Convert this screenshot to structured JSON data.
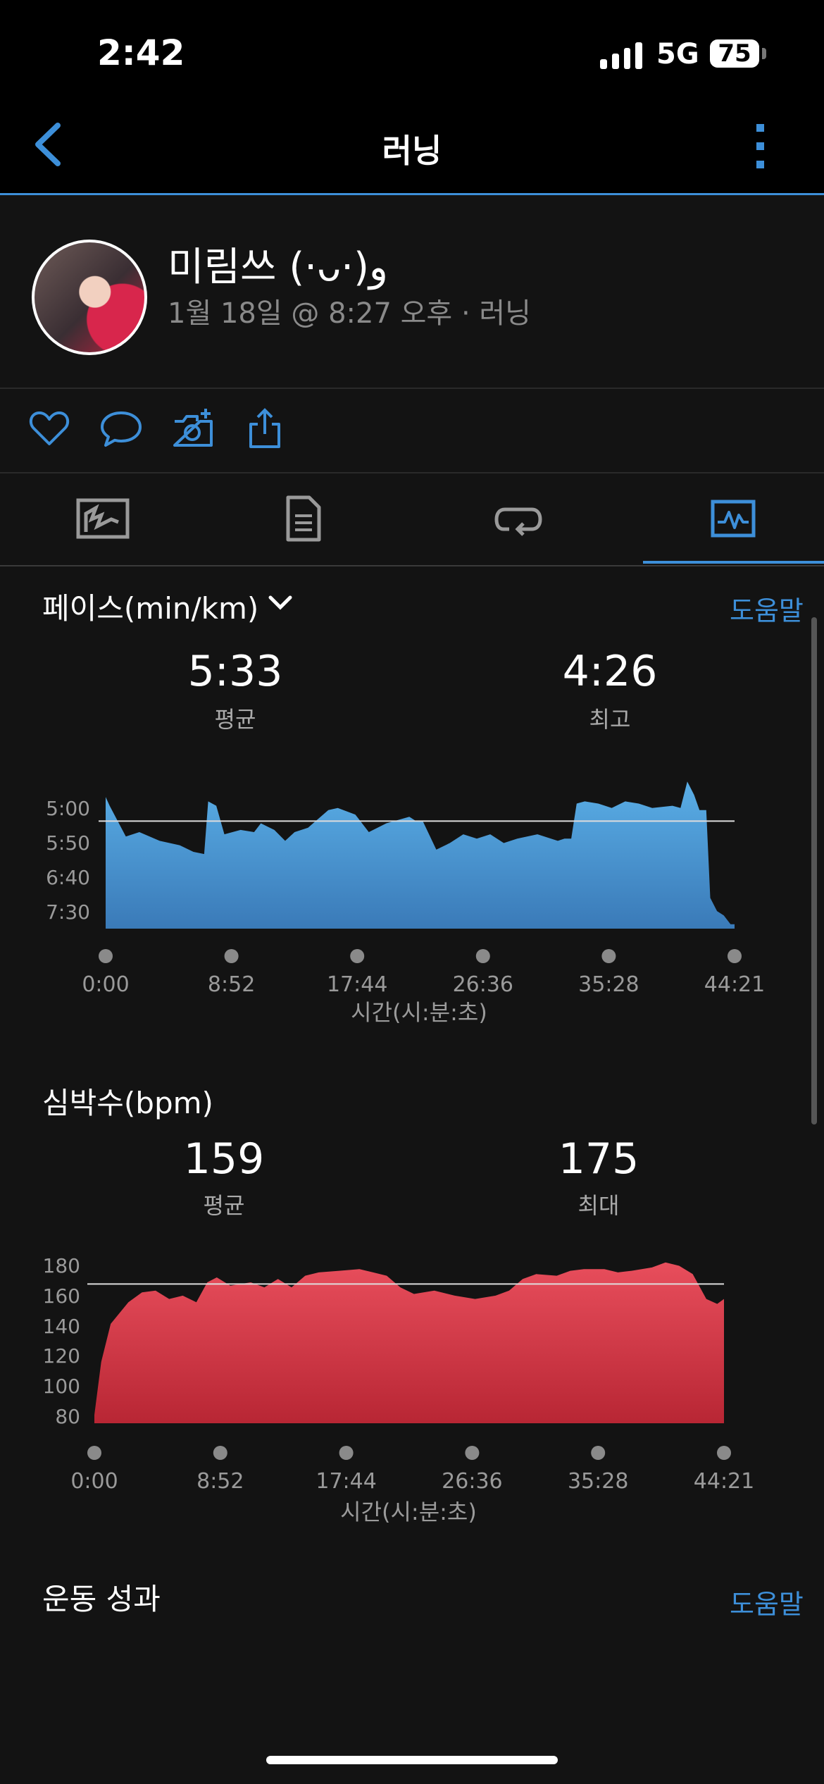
{
  "status_bar": {
    "time": "2:42",
    "network": "5G",
    "battery": "75"
  },
  "nav": {
    "title": "러닝"
  },
  "activity": {
    "user_name": "미림쓰 (·ᴗ·)و",
    "meta": "1월 18일 @ 8:27 오후 · 러닝"
  },
  "pace": {
    "title": "페이스(min/km)",
    "help": "도움말",
    "avg_value": "5:33",
    "avg_label": "평균",
    "best_value": "4:26",
    "best_label": "최고",
    "y_ticks": [
      "5:00",
      "5:50",
      "6:40",
      "7:30"
    ],
    "x_ticks": [
      "0:00",
      "8:52",
      "17:44",
      "26:36",
      "35:28",
      "44:21"
    ],
    "x_label": "시간(시:분:초)"
  },
  "heart": {
    "title": "심박수(bpm)",
    "avg_value": "159",
    "avg_label": "평균",
    "max_value": "175",
    "max_label": "최대",
    "y_ticks": [
      "180",
      "160",
      "140",
      "120",
      "100",
      "80"
    ],
    "x_ticks": [
      "0:00",
      "8:52",
      "17:44",
      "26:36",
      "35:28",
      "44:21"
    ],
    "x_label": "시간(시:분:초)"
  },
  "performance": {
    "title": "운동 성과",
    "help": "도움말"
  },
  "colors": {
    "accent": "#3d8fd9",
    "pace_fill": "#4a9ed8",
    "hr_fill": "#d63848"
  },
  "chart_data": [
    {
      "type": "area",
      "title": "페이스(min/km)",
      "xlabel": "시간(시:분:초)",
      "x_unit": "minutes",
      "y_unit": "min/km (inverted axis)",
      "ylim": [
        4.5,
        8.0
      ],
      "average": 5.55,
      "points": [
        [
          0,
          5.0
        ],
        [
          0.3,
          5.2
        ],
        [
          1.5,
          5.9
        ],
        [
          2.5,
          5.8
        ],
        [
          4,
          6.0
        ],
        [
          5.5,
          6.1
        ],
        [
          6.5,
          6.25
        ],
        [
          7.3,
          6.3
        ],
        [
          7.6,
          5.1
        ],
        [
          8.2,
          5.2
        ],
        [
          8.8,
          5.85
        ],
        [
          10,
          5.75
        ],
        [
          11,
          5.8
        ],
        [
          11.5,
          5.6
        ],
        [
          12.5,
          5.75
        ],
        [
          13.3,
          6.0
        ],
        [
          14,
          5.8
        ],
        [
          15,
          5.7
        ],
        [
          16.5,
          5.3
        ],
        [
          17.2,
          5.25
        ],
        [
          18.5,
          5.4
        ],
        [
          19.5,
          5.8
        ],
        [
          20.8,
          5.6
        ],
        [
          22.5,
          5.45
        ],
        [
          23,
          5.55
        ],
        [
          23.5,
          5.55
        ],
        [
          24.5,
          6.2
        ],
        [
          25.5,
          6.05
        ],
        [
          26.5,
          5.85
        ],
        [
          27.5,
          5.95
        ],
        [
          28.5,
          5.85
        ],
        [
          29.5,
          6.05
        ],
        [
          30.5,
          5.95
        ],
        [
          32,
          5.85
        ],
        [
          33.5,
          6.0
        ],
        [
          34,
          5.95
        ],
        [
          34.5,
          5.95
        ],
        [
          34.9,
          5.15
        ],
        [
          35.5,
          5.1
        ],
        [
          36.5,
          5.15
        ],
        [
          37.5,
          5.25
        ],
        [
          38.5,
          5.1
        ],
        [
          39.5,
          5.15
        ],
        [
          40.5,
          5.25
        ],
        [
          42,
          5.2
        ],
        [
          42.6,
          5.25
        ],
        [
          43.1,
          4.65
        ],
        [
          43.6,
          4.95
        ],
        [
          44.0,
          5.3
        ],
        [
          44.5,
          5.3
        ],
        [
          44.8,
          7.3
        ],
        [
          45.3,
          7.6
        ],
        [
          45.8,
          7.7
        ],
        [
          46.3,
          7.9
        ],
        [
          46.6,
          7.9
        ]
      ]
    },
    {
      "type": "area",
      "title": "심박수(bpm)",
      "xlabel": "시간(시:분:초)",
      "x_unit": "minutes",
      "y_unit": "bpm",
      "ylim": [
        75,
        180
      ],
      "average": 159,
      "points": [
        [
          0,
          80
        ],
        [
          0.5,
          112
        ],
        [
          1.2,
          135
        ],
        [
          2.5,
          148
        ],
        [
          3.5,
          154
        ],
        [
          4.5,
          155
        ],
        [
          5.5,
          150
        ],
        [
          6.5,
          152
        ],
        [
          7.5,
          148
        ],
        [
          8.3,
          160
        ],
        [
          9,
          163
        ],
        [
          10,
          158
        ],
        [
          11.5,
          160
        ],
        [
          12.5,
          157
        ],
        [
          13.5,
          162
        ],
        [
          14.5,
          157
        ],
        [
          15.5,
          164
        ],
        [
          16.5,
          166
        ],
        [
          18,
          167
        ],
        [
          19.5,
          168
        ],
        [
          20.5,
          166
        ],
        [
          21.5,
          164
        ],
        [
          22.5,
          157
        ],
        [
          23.5,
          153
        ],
        [
          25,
          155
        ],
        [
          26.5,
          152
        ],
        [
          28,
          150
        ],
        [
          29.5,
          152
        ],
        [
          30.5,
          155
        ],
        [
          31.5,
          162
        ],
        [
          32.5,
          165
        ],
        [
          34,
          164
        ],
        [
          35,
          167
        ],
        [
          36,
          168
        ],
        [
          37.5,
          168
        ],
        [
          38.5,
          166
        ],
        [
          39.5,
          167
        ],
        [
          41,
          169
        ],
        [
          42,
          172
        ],
        [
          43,
          170
        ],
        [
          44,
          165
        ],
        [
          45,
          150
        ],
        [
          45.8,
          147
        ],
        [
          46.3,
          150
        ]
      ]
    }
  ]
}
